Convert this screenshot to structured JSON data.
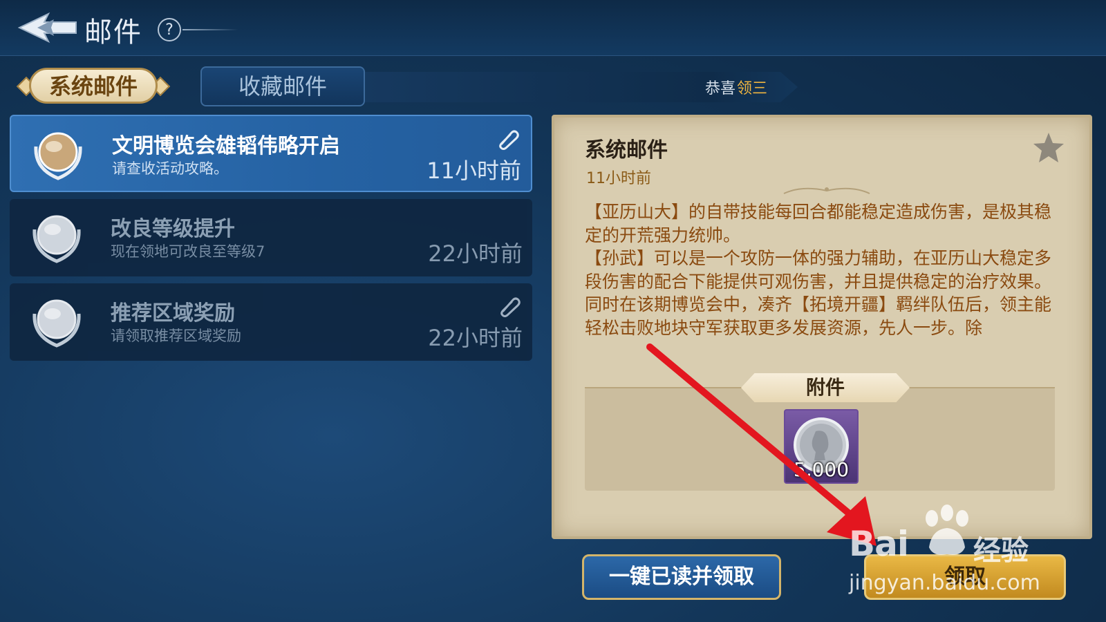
{
  "header": {
    "title": "邮件",
    "help": "?"
  },
  "tabs": [
    {
      "label": "系统邮件",
      "selected": true
    },
    {
      "label": "收藏邮件",
      "selected": false
    }
  ],
  "ticker": {
    "text_white": "恭喜",
    "text_gold": "领三"
  },
  "mails": [
    {
      "title": "文明博览会雄韬伟略开启",
      "subtitle": "请查收活动攻略。",
      "time": "11小时前",
      "has_attachment": true,
      "selected": true
    },
    {
      "title": "改良等级提升",
      "subtitle": "现在领地可改良至等级7",
      "time": "22小时前",
      "has_attachment": false,
      "selected": false
    },
    {
      "title": "推荐区域奖励",
      "subtitle": "请领取推荐区域奖励",
      "time": "22小时前",
      "has_attachment": true,
      "selected": false
    }
  ],
  "detail": {
    "title": "系统邮件",
    "time": "11小时前",
    "paragraphs": [
      "【亚历山大】的自带技能每回合都能稳定造成伤害，是极其稳定的开荒强力统帅。",
      "【孙武】可以是一个攻防一体的强力辅助，在亚历山大稳定多段伤害的配合下能提供可观伤害，并且提供稳定的治疗效果。",
      "同时在该期博览会中，凑齐【拓境开疆】羁绊队伍后，领主能轻松击败地块守军获取更多发展资源，先人一步。除"
    ],
    "attachment_label": "附件",
    "attachment_item": {
      "icon": "silver-coin-icon",
      "count": "5,000"
    }
  },
  "buttons": {
    "read_all": "一键已读并领取",
    "claim": "领取"
  },
  "watermark": {
    "brand": "Bai",
    "brand_cn": "经验",
    "url": "jingyan.baidu.com"
  },
  "colors": {
    "accent_gold": "#f0b540",
    "selected_row": "#2f6fb2",
    "panel_bg": "#d9cdb0",
    "body_text": "#8a4a10",
    "arrow": "#e3161f"
  }
}
